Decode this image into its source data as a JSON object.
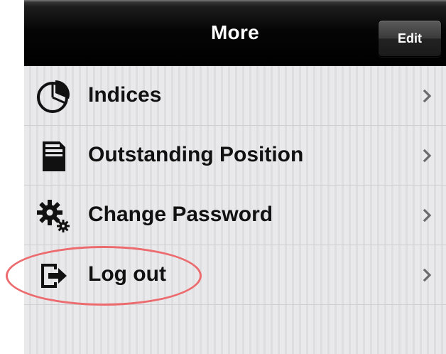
{
  "navbar": {
    "title": "More",
    "edit_label": "Edit"
  },
  "menu": {
    "items": [
      {
        "label": "Indices",
        "icon": "pie-chart-icon"
      },
      {
        "label": "Outstanding Position",
        "icon": "document-icon"
      },
      {
        "label": "Change Password",
        "icon": "gears-icon"
      },
      {
        "label": "Log out",
        "icon": "logout-icon"
      }
    ]
  },
  "annotation": {
    "highlight_color": "#ec6b6e",
    "highlighted_item": "Log out"
  }
}
